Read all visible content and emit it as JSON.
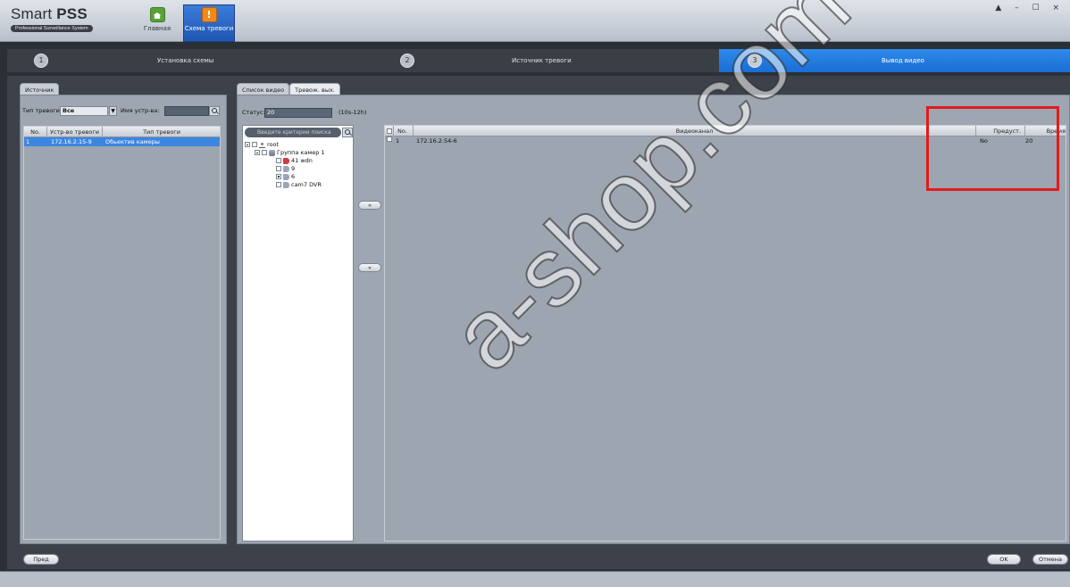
{
  "app": {
    "brand_light": "Smart ",
    "brand_bold": "PSS",
    "subtitle": "Professional Surveillance System"
  },
  "header_tabs": [
    {
      "label": "Главная",
      "icon": "home-icon"
    },
    {
      "label": "Схема тревоги",
      "icon": "alarm-icon",
      "active": true
    }
  ],
  "window_controls": {
    "glyphs": "▲ – ☐ ×"
  },
  "steps": [
    {
      "num": "1",
      "title": "Установка схемы"
    },
    {
      "num": "2",
      "title": "Источник тревоги"
    },
    {
      "num": "3",
      "title": "Вывод видео",
      "active": true
    }
  ],
  "source_panel": {
    "tab": "Источник",
    "alarm_type_label": "Тип тревоги",
    "alarm_type_value": "Все",
    "device_name_label": "Имя устр-ва:",
    "device_name_value": "",
    "columns": [
      "No.",
      "Устр-во тревоги",
      "Тип тревоги"
    ],
    "rows": [
      {
        "no": "1",
        "device": "172.16.2.15-9",
        "type": "Обьектив камеры"
      }
    ]
  },
  "output_panel": {
    "tabs": [
      "Список видео",
      "Тревож. вых."
    ],
    "status_label": "Статус:",
    "status_value": "20",
    "status_hint": "(10s-12h)",
    "tree_search_placeholder": "Введите критерии поиска",
    "tree": {
      "root": "root",
      "group": "Группа камер 1",
      "cameras": [
        "41 wdn",
        "9",
        "6",
        "cam7 DVR"
      ]
    },
    "move_right": "»",
    "move_left": "«",
    "columns": [
      "No.",
      "Видеоканал",
      "Предуст.",
      "Время"
    ],
    "rows": [
      {
        "no": "1",
        "channel": "172.16.2.54-6",
        "preset": "No",
        "time": "20"
      }
    ]
  },
  "footer": {
    "prev": "Пред",
    "ok": "OK",
    "cancel": "Отмена"
  },
  "watermark": "a-shop.com",
  "colors": {
    "accent_blue": "#1a6dd4",
    "selection_blue": "#3c86e0",
    "highlight_red": "#e21b1b"
  }
}
